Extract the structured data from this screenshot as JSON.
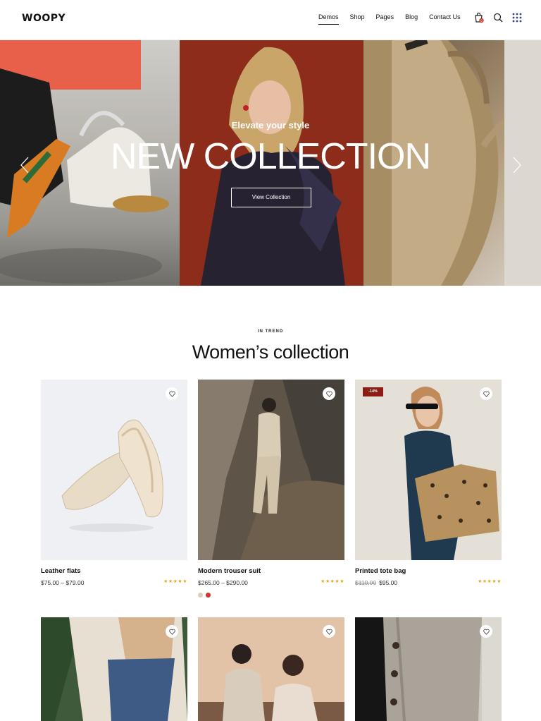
{
  "header": {
    "logo": "WOOPY",
    "nav": [
      "Demos",
      "Shop",
      "Pages",
      "Blog",
      "Contact Us"
    ],
    "cart_count": "0",
    "icons": [
      "cart-icon",
      "search-icon",
      "grid-menu-icon"
    ]
  },
  "hero": {
    "subtitle": "Elevate your style",
    "title": "NEW COLLECTION",
    "button": "View Collection"
  },
  "section": {
    "kicker": "IN TREND",
    "title": "Women’s collection"
  },
  "products": [
    {
      "name": "Leather flats",
      "price": "$75.00 – $79.00",
      "rating": "★★★★★"
    },
    {
      "name": "Modern trouser suit",
      "price": "$265.00 – $290.00",
      "rating": "★★★★★",
      "swatches": [
        "#d9cfb9",
        "#d2342b"
      ]
    },
    {
      "name": "Printed tote bag",
      "old_price": "$110.00",
      "price": "$95.00",
      "badge": "-14%",
      "rating": "★★★★★"
    }
  ],
  "colors": {
    "accent": "#8b1d14",
    "stars": "#e0a92a"
  }
}
